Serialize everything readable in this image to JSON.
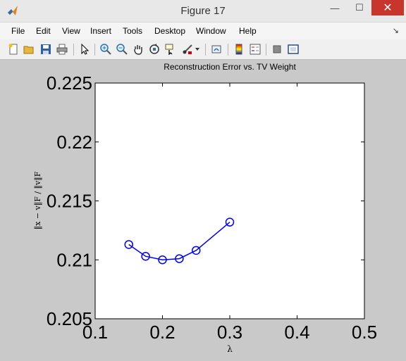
{
  "window": {
    "title": "Figure 17",
    "minimize": "—",
    "maximize": "☐",
    "close": "✕"
  },
  "menu": {
    "items": [
      "File",
      "Edit",
      "View",
      "Insert",
      "Tools",
      "Desktop",
      "Window",
      "Help"
    ],
    "overflow_arrow": "↘"
  },
  "toolbar": {
    "icons": [
      "new-figure-icon",
      "open-folder-icon",
      "save-icon",
      "print-icon",
      "arrow-pointer-icon",
      "zoom-in-icon",
      "zoom-out-icon",
      "pan-hand-icon",
      "rotate-3d-icon",
      "data-cursor-icon",
      "brush-icon",
      "link-plot-icon",
      "colorbar-icon",
      "legend-icon",
      "hide-plot-tools-icon",
      "show-plot-tools-icon"
    ]
  },
  "chart_data": {
    "type": "line",
    "title": "Reconstruction Error vs. TV Weight",
    "xlabel": "λ",
    "ylabel": "‖x − v‖F / ‖v‖F",
    "xlim": [
      0.1,
      0.5
    ],
    "ylim": [
      0.205,
      0.225
    ],
    "xticks": [
      "0.1",
      "0.2",
      "0.3",
      "0.4",
      "0.5"
    ],
    "xtick_values": [
      0.1,
      0.2,
      0.3,
      0.4,
      0.5
    ],
    "yticks": [
      "0.205",
      "0.21",
      "0.215",
      "0.22",
      "0.225"
    ],
    "ytick_values": [
      0.205,
      0.21,
      0.215,
      0.22,
      0.225
    ],
    "grid": false,
    "series": [
      {
        "color": "#0000ff",
        "marker": "circle",
        "x": [
          0.15,
          0.175,
          0.2,
          0.225,
          0.25,
          0.3
        ],
        "y": [
          0.2113,
          0.2103,
          0.21,
          0.2101,
          0.2108,
          0.2132
        ]
      }
    ]
  }
}
